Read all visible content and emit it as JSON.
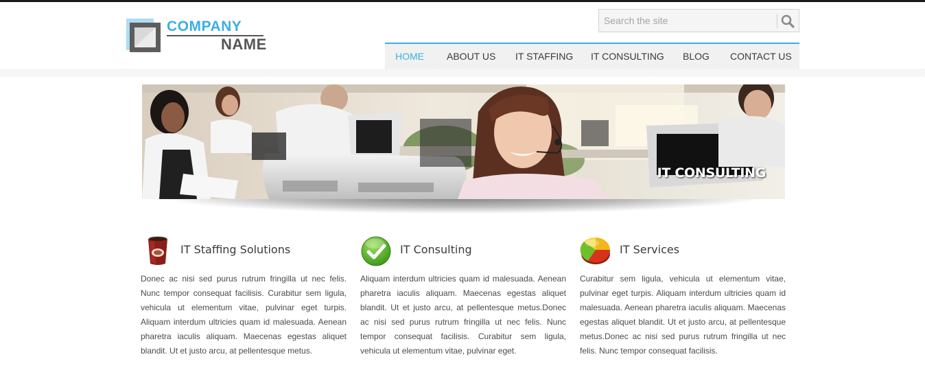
{
  "logo": {
    "line1": "COMPANY",
    "line2": "NAME"
  },
  "search": {
    "placeholder": "Search the site",
    "button_icon": "search-icon"
  },
  "nav": {
    "items": [
      {
        "label": "HOME",
        "active": true
      },
      {
        "label": "ABOUT US",
        "active": false
      },
      {
        "label": "IT STAFFING",
        "active": false
      },
      {
        "label": "IT CONSULTING",
        "active": false
      },
      {
        "label": "BLOG",
        "active": false
      },
      {
        "label": "CONTACT US",
        "active": false
      }
    ],
    "accent_color": "#3ab0e2"
  },
  "banner": {
    "caption": "IT CONSULTING"
  },
  "features": [
    {
      "icon": "coffee-cup-icon",
      "title": "IT Staffing Solutions",
      "text": "Donec ac nisi sed purus rutrum fringilla ut nec felis. Nunc tempor consequat facilisis. Curabitur sem ligula, vehicula ut elementum vitae, pulvinar eget turpis. Aliquam interdum ultricies quam id malesuada. Aenean pharetra iaculis aliquam. Maecenas egestas aliquet blandit. Ut et justo arcu, at pellentesque metus."
    },
    {
      "icon": "checkmark-icon",
      "title": "IT Consulting",
      "text": "Aliquam interdum ultricies quam id malesuada. Aenean pharetra iaculis aliquam. Maecenas egestas aliquet blandit. Ut et justo arcu, at pellentesque metus.Donec ac nisi sed purus rutrum fringilla ut nec felis. Nunc tempor consequat facilisis. Curabitur sem ligula, vehicula ut elementum vitae, pulvinar eget."
    },
    {
      "icon": "pie-chart-icon",
      "title": "IT Services",
      "text": "Curabitur sem ligula, vehicula ut elementum vitae, pulvinar eget turpis. Aliquam interdum ultricies quam id malesuada. Aenean pharetra iaculis aliquam. Maecenas egestas aliquet blandit. Ut et justo arcu, at pellentesque metus.Donec ac nisi sed purus rutrum fringilla ut nec felis. Nunc tempor consequat facilisis."
    }
  ]
}
